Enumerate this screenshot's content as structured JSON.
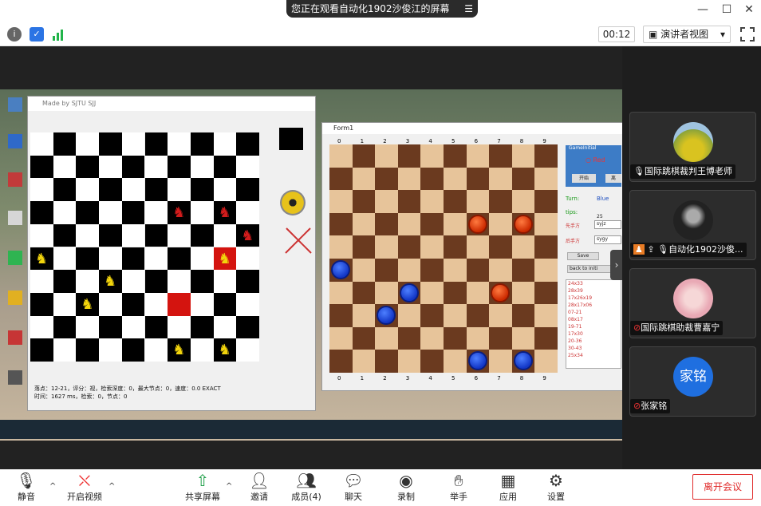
{
  "share_banner": {
    "text": "您正在观看自动化1902沙俊江的屏幕"
  },
  "timer": "00:12",
  "view_mode": "演讲者视图",
  "left_game": {
    "title": "Made by SJTU SJJ",
    "status_line1": "落点：12-21，评分：视，检索深度：0，最大节点：0，速度：0.0 EXACT",
    "status_line2": "时间：1627 ms，检索：0，节点：0"
  },
  "right_game": {
    "title": "Form1",
    "groupbox_title": "GameInitial",
    "radio_red": "Red",
    "start_btn": "开始",
    "second_btn": "离",
    "turn_label": "Turn:",
    "turn_value": "Blue",
    "tips_label": "tips:",
    "tips_value": "25",
    "first_hand_label": "先手方",
    "first_hand_value": "syjz",
    "second_hand_label": "后手方",
    "second_hand_value": "sygy",
    "save_btn": "Save",
    "back_btn": "back to initi",
    "moves": [
      "24x33",
      "28x39",
      "17x26x19",
      "28x17x06",
      "07-21",
      "08x17",
      "19-71",
      "17x30",
      "20-36",
      "30-43",
      "25x34"
    ]
  },
  "participants": [
    {
      "name": "国际跳棋裁判王博老师"
    },
    {
      "name": "自动化1902沙俊..."
    },
    {
      "name": "国际跳棋助裁曹嘉宁"
    },
    {
      "name": "张家铭",
      "avatar_text": "家铭"
    }
  ],
  "toolbar": {
    "mute": "静音",
    "video": "开启视频",
    "share": "共享屏幕",
    "invite": "邀请",
    "members": "成员(4)",
    "chat": "聊天",
    "record": "录制",
    "raise_hand": "举手",
    "apps": "应用",
    "settings": "设置",
    "leave": "离开会议"
  }
}
